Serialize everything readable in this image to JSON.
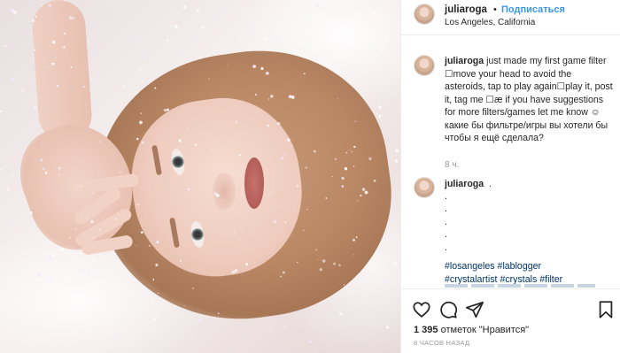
{
  "header": {
    "username": "juliaroga",
    "separator": "•",
    "follow_label": "Подписаться",
    "location": "Los Angeles, California",
    "more_label": "..."
  },
  "caption": {
    "username": "juliaroga",
    "text": " just made my first game filter ☐move your head to avoid the asteroids, tap to play again☐play it, post it, tag me ☐æ if you have suggestions for more filters/games let me know ☺",
    "text_ru": "какие бы фильтре/игры вы хотели бы чтобы я ещё сделала?",
    "time": "8 ч."
  },
  "comment": {
    "username": "juliaroga",
    "text": ".",
    "dots": [
      ".",
      ".",
      ".",
      ".",
      "."
    ],
    "hashtags": [
      "#losangeles",
      "#lablogger",
      "#crystalartist",
      "#crystals",
      "#filter"
    ]
  },
  "actions": {
    "likes_count": "1 395",
    "likes_label": "отметок \"Нравится\"",
    "time_ago": "8 ЧАСОВ НАЗАД"
  },
  "icons": {
    "like": "heart-icon",
    "comment": "comment-icon",
    "share": "share-icon",
    "save": "bookmark-icon"
  }
}
